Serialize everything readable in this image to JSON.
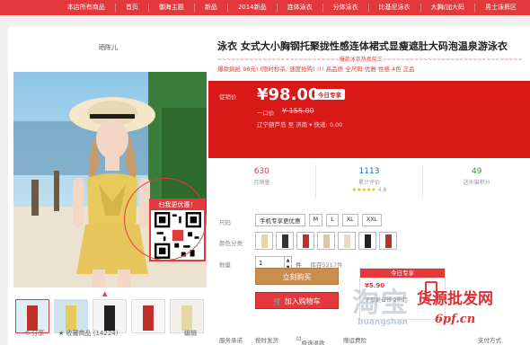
{
  "topnav": {
    "items": [
      "本店所有商品",
      "首页",
      "御海主题",
      "新品",
      "2014新品",
      "连体泳衣",
      "分体泳衣",
      "比基尼泳衣",
      "大胸/加大码",
      "男士泳裤区"
    ]
  },
  "shop": {
    "name": "晒陈儿"
  },
  "qr": {
    "header": "扫我更优惠！"
  },
  "gallery": {
    "thumb_count": 5
  },
  "left_footer": {
    "share": "分享",
    "favorite": "收藏商品",
    "favorite_count": "14224",
    "edit": "编辑"
  },
  "product": {
    "title": "泳衣 女式大小胸钢托聚拢性感连体裙式显瘦遮肚大码泡温泉游泳衣",
    "slogan": "~~~~~~~~~~~~~~~~~~~~~~~~~~~爆款泳衣热卖前三~~~~~~~~~~~~~~~~~~~~~~~~~~~~~~~~~~~",
    "promo": "爆款疯抢 98元! (限时秒杀, 速度抢购) !!! 高品质 全尺码 优雅 性感 4色 正品"
  },
  "price": {
    "label": "促销价",
    "value": "¥98.00",
    "badge": "今日专享",
    "orig_label": "一口价",
    "orig_value": "¥ 155.00",
    "shipping": "辽宁葫芦岛 至 济南 ▾ 快递: 0.00"
  },
  "stats": [
    {
      "num": "630",
      "cap": "月销量",
      "color": "#e4393c"
    },
    {
      "num": "1113",
      "cap": "累计评价",
      "stars": "★★★★★",
      "score": "4.8",
      "color": "#1a6bc4"
    },
    {
      "num": "49",
      "cap": "送天猫积分",
      "color": "#2a9a2a"
    }
  ],
  "size": {
    "label": "尺码",
    "options": [
      "手机专享更优惠",
      "M",
      "L",
      "XL",
      "XXL"
    ]
  },
  "color": {
    "label": "颜色分类",
    "swatch_colors": [
      "#e8d6a0",
      "#333333",
      "#c0302a",
      "#d8c8a8",
      "#e8dcc0",
      "#222222",
      "#c0302a"
    ]
  },
  "quantity": {
    "label": "数量",
    "value": "1",
    "unit": "件",
    "stock": "库存5217件"
  },
  "buttons": {
    "buy": "立刻购买",
    "cart": "加入购物车"
  },
  "app_promo": {
    "header": "今日专享",
    "app_label": "¥5.90",
    "store_label": "下单更省钱 2折起"
  },
  "services": {
    "label": "服务承诺",
    "items": [
      "按时发货",
      "极速退款",
      "赠运费险"
    ],
    "more": "支付方式"
  },
  "watermark": {
    "a": "淘宝",
    "b": "货源批发网",
    "c": "6pf.cn",
    "d": "buangshan"
  }
}
